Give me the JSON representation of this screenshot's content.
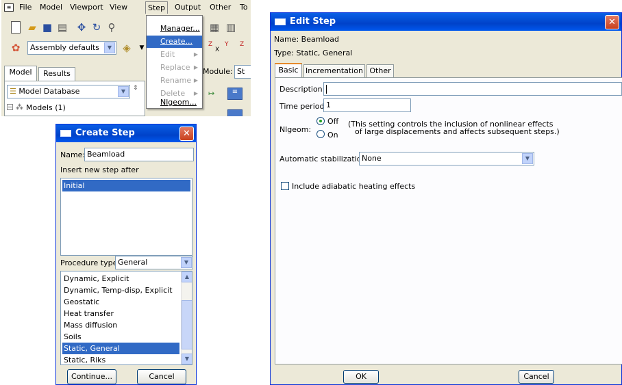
{
  "app": {
    "menu": [
      "File",
      "Model",
      "Viewport",
      "View",
      "Step",
      "Output",
      "Other",
      "To"
    ],
    "assembly_combo": "Assembly defaults",
    "tabs": [
      "Model",
      "Results"
    ],
    "model_combo": "Model Database",
    "module_label": "Module:",
    "module_value": "St",
    "tree_item": "Models (1)",
    "step_menu": [
      "Manager...",
      "Create...",
      "Edit",
      "Replace",
      "Rename",
      "Delete",
      "Nlgeom..."
    ],
    "axis_labels": [
      "Z",
      "X",
      "Y",
      "Z"
    ]
  },
  "create_step": {
    "title": "Create Step",
    "name_label": "Name:",
    "name_value": "Beamload",
    "insert_label": "Insert new step after",
    "insert_items": [
      "Initial"
    ],
    "procedure_label": "Procedure type:",
    "procedure_value": "General",
    "procedures": [
      "Dynamic, Explicit",
      "Dynamic, Temp-disp, Explicit",
      "Geostatic",
      "Heat transfer",
      "Mass diffusion",
      "Soils",
      "Static, General",
      "Static, Riks"
    ],
    "continue_label": "Continue...",
    "cancel_label": "Cancel"
  },
  "edit_step": {
    "title": "Edit Step",
    "name_line": "Name:  Beamload",
    "type_line": "Type:  Static, General",
    "tabs": [
      "Basic",
      "Incrementation",
      "Other"
    ],
    "description_label": "Description:",
    "description_value": "",
    "time_label": "Time period:",
    "time_value": "1",
    "nlgeom_label": "Nlgeom:",
    "off_label": "Off",
    "on_label": "On",
    "nlgeom_note_1": "(This setting controls the inclusion of nonlinear effects",
    "nlgeom_note_2": "of large displacements and affects subsequent steps.)",
    "stab_label": "Automatic stabilization:",
    "stab_value": "None",
    "adiabatic_label": "Include adiabatic heating effects",
    "ok_label": "OK",
    "cancel_label": "Cancel"
  },
  "colors": {
    "title_blue": "#0054e3",
    "selection": "#316ac5",
    "close_red": "#d9552f",
    "dialog_bg": "#ece9d8"
  }
}
